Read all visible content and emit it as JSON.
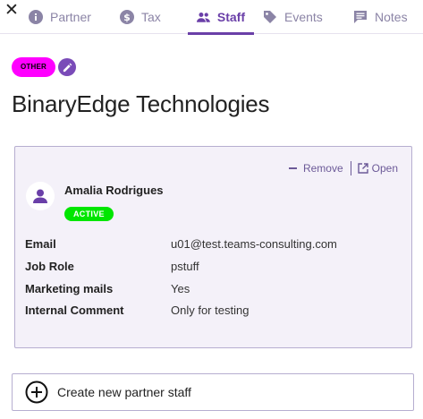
{
  "nav": {
    "close_icon": "close-icon",
    "tabs": [
      {
        "label": "Partner",
        "icon": "info-icon",
        "active": false
      },
      {
        "label": "Tax",
        "icon": "dollar-icon",
        "active": false
      },
      {
        "label": "Staff",
        "icon": "people-icon",
        "active": true
      },
      {
        "label": "Events",
        "icon": "tag-icon",
        "active": false
      },
      {
        "label": "Notes",
        "icon": "comment-icon",
        "active": false
      }
    ]
  },
  "header": {
    "category_badge": "OTHER",
    "title": "BinaryEdge Technologies"
  },
  "staff_card": {
    "remove_label": "Remove",
    "open_label": "Open",
    "name": "Amalia Rodrigues",
    "status": "ACTIVE",
    "fields": [
      {
        "label": "Email",
        "value": "u01@test.teams-consulting.com"
      },
      {
        "label": "Job Role",
        "value": "pstuff"
      },
      {
        "label": "Marketing mails",
        "value": "Yes"
      },
      {
        "label": "Internal Comment",
        "value": "Only for testing"
      }
    ]
  },
  "create_button": {
    "label": "Create new partner staff"
  },
  "colors": {
    "accent": "#6a3fa8",
    "tab_inactive": "#8b84a6",
    "category_badge": "#ff00ff",
    "status_active": "#00e600",
    "card_background": "#f4f1f9",
    "card_border": "#b6aed0"
  }
}
